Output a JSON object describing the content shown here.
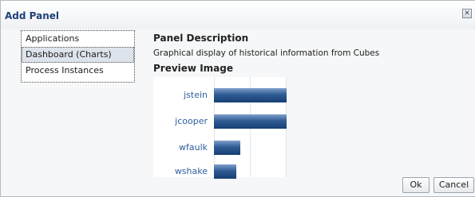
{
  "dialog": {
    "title": "Add Panel",
    "close_label": "✕"
  },
  "list": {
    "items": [
      {
        "label": "Applications",
        "selected": false
      },
      {
        "label": "Dashboard (Charts)",
        "selected": true
      },
      {
        "label": "Process Instances",
        "selected": false
      }
    ]
  },
  "description": {
    "heading": "Panel Description",
    "text": "Graphical display of historical information from Cubes"
  },
  "preview": {
    "heading": "Preview Image"
  },
  "chart_data": {
    "type": "bar",
    "orientation": "horizontal",
    "categories": [
      "jstein",
      "jcooper",
      "wfaulk",
      "wshake"
    ],
    "values": [
      100,
      100,
      36,
      31
    ],
    "xlim": [
      0,
      100
    ],
    "grid": true,
    "bar_color": "#2f5b94"
  },
  "buttons": {
    "ok_label": "Ok",
    "cancel_label": "Cancel"
  }
}
